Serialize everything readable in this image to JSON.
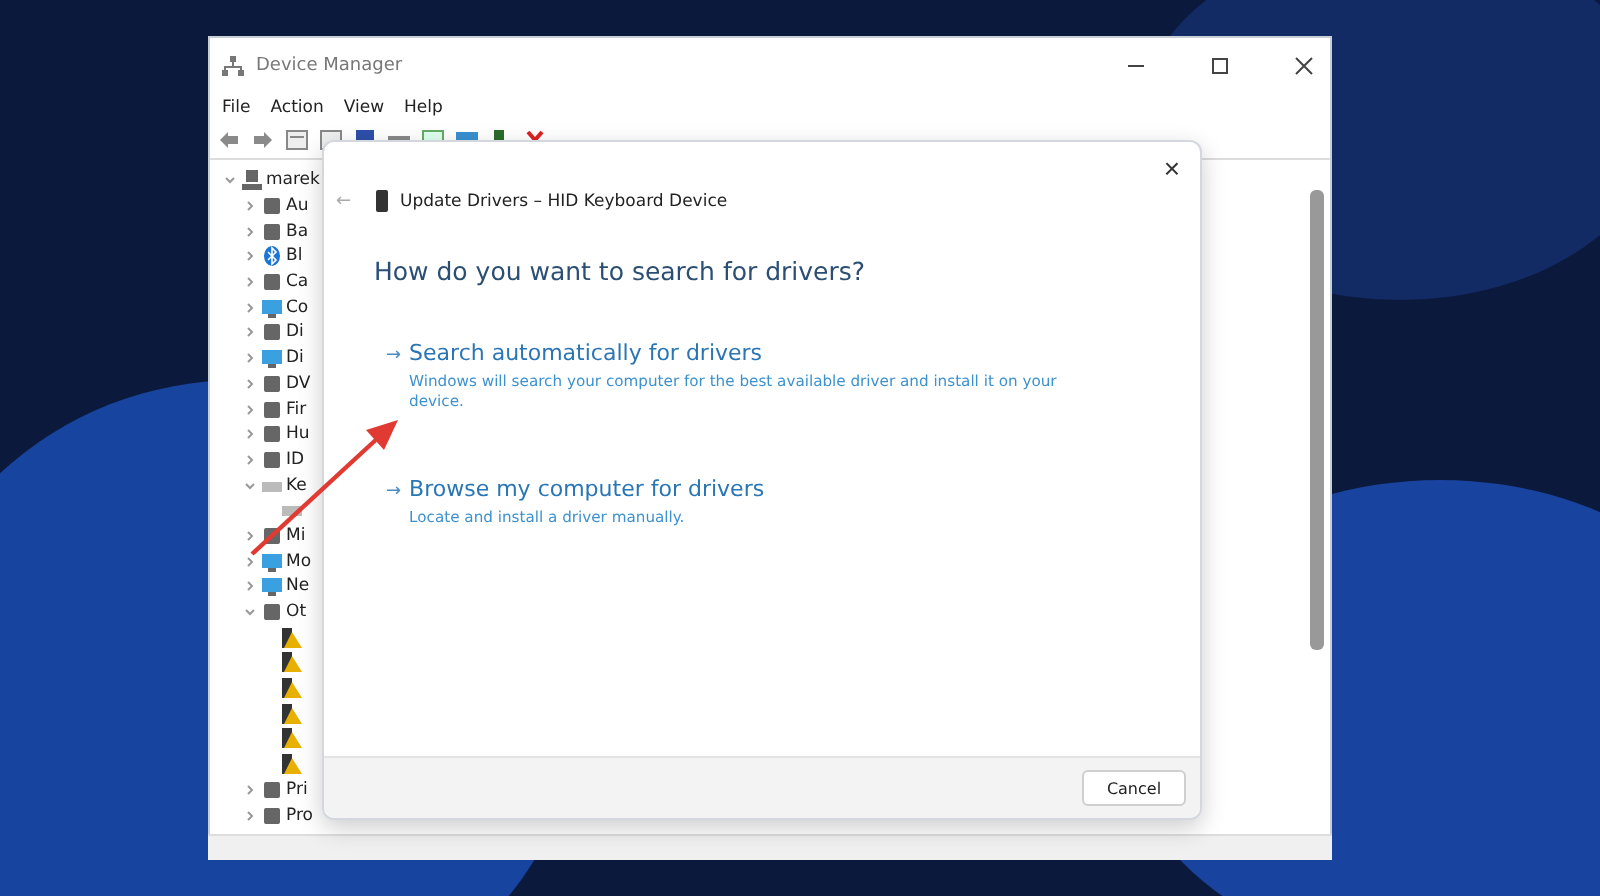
{
  "window": {
    "title": "Device Manager"
  },
  "menu": [
    "File",
    "Action",
    "View",
    "Help"
  ],
  "tree": {
    "label": "marek",
    "expanded": true,
    "children": [
      {
        "label": "Au",
        "kind": "device",
        "expanded": false
      },
      {
        "label": "Ba",
        "kind": "device",
        "expanded": false
      },
      {
        "label": "Bl",
        "kind": "bluetooth",
        "expanded": false
      },
      {
        "label": "Ca",
        "kind": "device",
        "expanded": false
      },
      {
        "label": "Co",
        "kind": "monitor",
        "expanded": false
      },
      {
        "label": "Di",
        "kind": "device",
        "expanded": false
      },
      {
        "label": "Di",
        "kind": "monitor",
        "expanded": false
      },
      {
        "label": "DV",
        "kind": "device",
        "expanded": false
      },
      {
        "label": "Fir",
        "kind": "device",
        "expanded": false
      },
      {
        "label": "Hu",
        "kind": "device",
        "expanded": false
      },
      {
        "label": "ID",
        "kind": "device",
        "expanded": false
      },
      {
        "label": "Ke",
        "kind": "keyboard",
        "expanded": true,
        "children": [
          {
            "kind": "keyboard"
          }
        ]
      },
      {
        "label": "Mi",
        "kind": "device",
        "expanded": false
      },
      {
        "label": "Mo",
        "kind": "monitor",
        "expanded": false
      },
      {
        "label": "Ne",
        "kind": "monitor",
        "expanded": false
      },
      {
        "label": "Ot",
        "kind": "device",
        "expanded": true,
        "children": [
          {
            "kind": "warning"
          },
          {
            "kind": "warning"
          },
          {
            "kind": "warning"
          },
          {
            "kind": "warning"
          },
          {
            "kind": "warning"
          },
          {
            "kind": "warning"
          }
        ]
      },
      {
        "label": "Pri",
        "kind": "device",
        "expanded": false
      },
      {
        "label": "Pro",
        "kind": "device",
        "expanded": false
      }
    ]
  },
  "dialog": {
    "back": "←",
    "title": "Update Drivers – HID Keyboard Device",
    "heading": "How do you want to search for drivers?",
    "options": [
      {
        "arrow": "→",
        "title": "Search automatically for drivers",
        "description": "Windows will search your computer for the best available driver and install it on your device."
      },
      {
        "arrow": "→",
        "title": "Browse my computer for drivers",
        "description": "Locate and install a driver manually."
      }
    ],
    "close": "×",
    "cancel": "Cancel"
  }
}
